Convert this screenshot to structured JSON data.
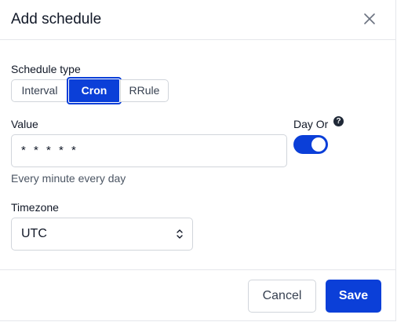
{
  "dialog": {
    "title": "Add schedule"
  },
  "schedule_type": {
    "label": "Schedule type",
    "options": [
      "Interval",
      "Cron",
      "RRule"
    ],
    "selected": "Cron"
  },
  "value": {
    "label": "Value",
    "input_value": "* * * * *",
    "hint": "Every minute every day"
  },
  "day_or": {
    "label": "Day Or",
    "help_glyph": "?",
    "enabled": true
  },
  "timezone": {
    "label": "Timezone",
    "selected": "UTC"
  },
  "footer": {
    "cancel_label": "Cancel",
    "save_label": "Save"
  },
  "colors": {
    "accent": "#0b3fd8",
    "border": "#d1d5db",
    "text": "#111827"
  }
}
